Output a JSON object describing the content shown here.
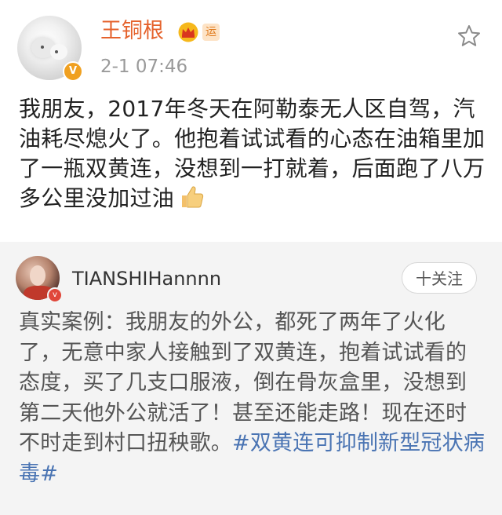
{
  "post": {
    "username": "王铜根",
    "badge_yun": "运",
    "timestamp": "2-1 07:46",
    "vip_badge": "V",
    "body": "我朋友，2017年冬天在阿勒泰无人区自驾，汽油耗尽熄火了。他抱着试试看的心态在油箱里加了一瓶双黄连，没想到一打就着，后面跑了八万多公里没加过油",
    "icons": {
      "star": "star-icon",
      "crown": "crown-icon",
      "thumb": "thumbs-up-icon"
    }
  },
  "comment": {
    "username": "TIANSHIHannnn",
    "follow_label": "十关注",
    "body": "真实案例：我朋友的外公，都死了两年了火化了，无意中家人接触到了双黄连，抱着试试看的态度，买了几支口服液，倒在骨灰盒里，没想到第二天他外公就活了！甚至还能走路！现在还时不时走到村口扭秧歌。",
    "hashtag": "#双黄连可抑制新型冠状病毒#",
    "vbadge": "v"
  },
  "colors": {
    "username_orange": "#e5622c",
    "hashtag_blue": "#4a74b3",
    "comment_bg": "#f4f4f4",
    "timestamp_gray": "#9a9a9a"
  }
}
